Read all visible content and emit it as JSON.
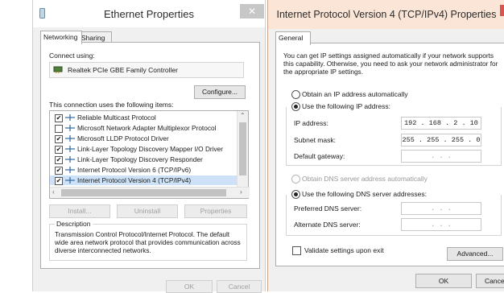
{
  "ethernet": {
    "title": "Ethernet Properties",
    "close": "✕",
    "tabs": [
      "Networking",
      "Sharing"
    ],
    "connect_using_label": "Connect using:",
    "adapter_name": "Realtek PCIe GBE Family Controller",
    "configure_label": "Configure...",
    "items_label": "This connection uses the following items:",
    "items": [
      {
        "label": "Reliable Multicast Protocol",
        "checked": true
      },
      {
        "label": "Microsoft Network Adapter Multiplexor Protocol",
        "checked": false
      },
      {
        "label": "Microsoft LLDP Protocol Driver",
        "checked": true
      },
      {
        "label": "Link-Layer Topology Discovery Mapper I/O Driver",
        "checked": true
      },
      {
        "label": "Link-Layer Topology Discovery Responder",
        "checked": true
      },
      {
        "label": "Internet Protocol Version 6 (TCP/IPv6)",
        "checked": true
      },
      {
        "label": "Internet Protocol Version 4 (TCP/IPv4)",
        "checked": true,
        "selected": true
      }
    ],
    "install_label": "Install...",
    "uninstall_label": "Uninstall",
    "properties_label": "Properties",
    "description_legend": "Description",
    "description_text": "Transmission Control Protocol/Internet Protocol. The default wide area network protocol that provides communication across diverse interconnected networks.",
    "ok_label": "OK",
    "cancel_label": "Cancel"
  },
  "ipv4": {
    "title": "Internet Protocol Version 4 (TCP/IPv4) Properties",
    "tab": "General",
    "intro": "You can get IP settings assigned automatically if your network supports this capability. Otherwise, you need to ask your network administrator for the appropriate IP settings.",
    "obtain_ip_auto": "Obtain an IP address automatically",
    "use_following_ip": "Use the following IP address:",
    "ip_address_label": "IP address:",
    "ip_address": "192 . 168 .  2  . 10",
    "subnet_label": "Subnet mask:",
    "subnet": "255 . 255 . 255 .  0",
    "gateway_label": "Default gateway:",
    "gateway": ".     .     .",
    "obtain_dns_auto": "Obtain DNS server address automatically",
    "use_following_dns": "Use the following DNS server addresses:",
    "preferred_dns_label": "Preferred DNS server:",
    "preferred_dns": ".     .     .",
    "alternate_dns_label": "Alternate DNS server:",
    "alternate_dns": ".     .     .",
    "validate_label": "Validate settings upon exit",
    "advanced_label": "Advanced...",
    "ok_label": "OK",
    "cancel_label": "Cancel"
  }
}
